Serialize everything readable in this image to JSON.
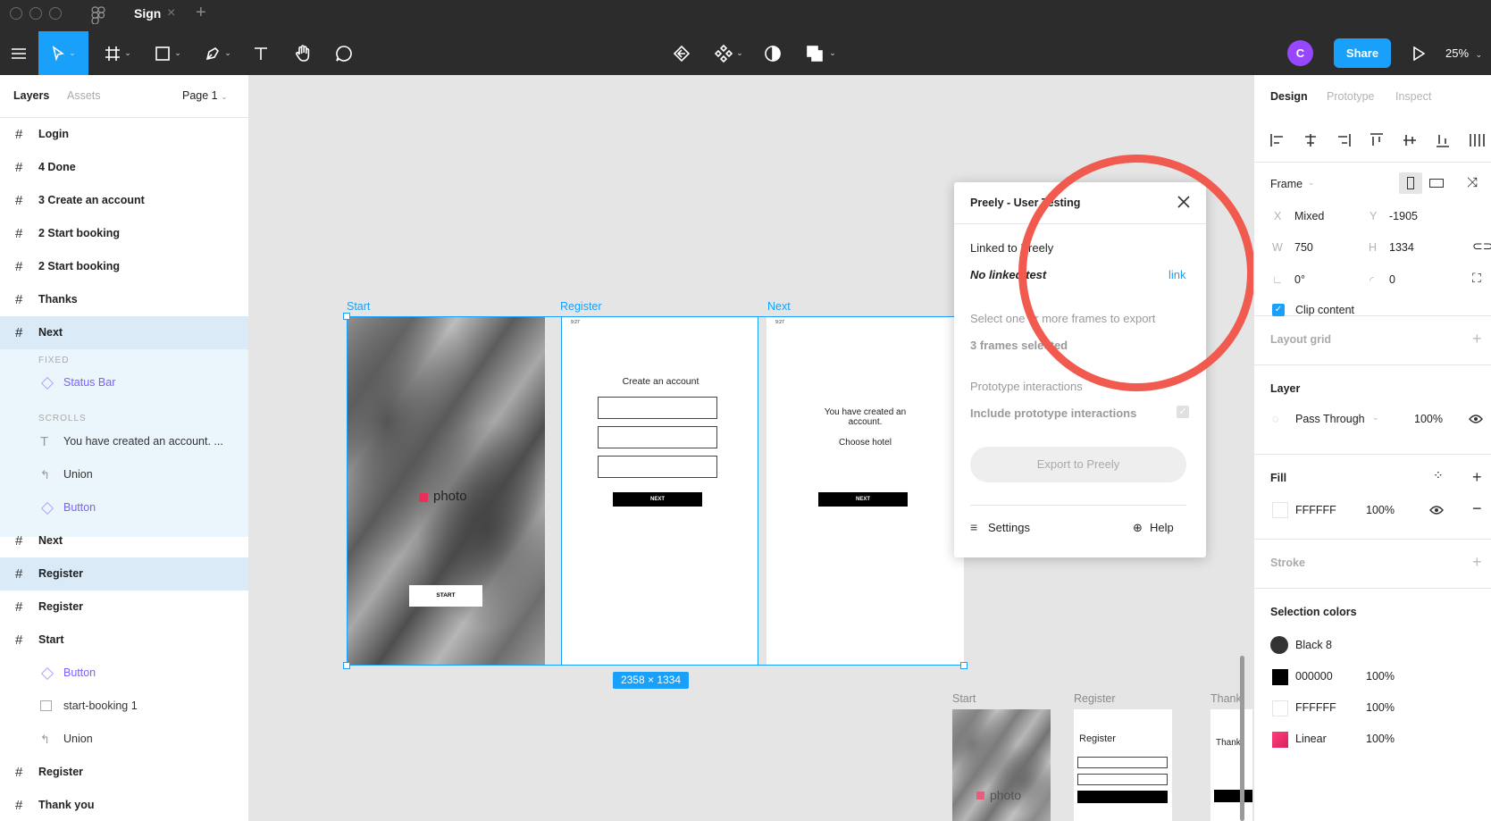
{
  "titlebar": {
    "tab_title": "Sign",
    "tab_close": "×",
    "tab_add": "+"
  },
  "toolbar": {
    "share_label": "Share",
    "avatar_initial": "C",
    "zoom": "25%",
    "accent_color": "#18a0fb"
  },
  "left_panel": {
    "tabs": [
      "Layers",
      "Assets"
    ],
    "page": "Page 1",
    "layers": [
      {
        "label": "Login"
      },
      {
        "label": "4 Done"
      },
      {
        "label": "3 Create an account"
      },
      {
        "label": "2 Start booking"
      },
      {
        "label": "2 Start booking"
      },
      {
        "label": "Thanks"
      },
      {
        "label": "Next"
      },
      {
        "label": "FIXED"
      },
      {
        "label": "Status Bar"
      },
      {
        "label": "SCROLLS"
      },
      {
        "label": "You have created an account. ..."
      },
      {
        "label": "Union"
      },
      {
        "label": "Button"
      },
      {
        "label": "Next"
      },
      {
        "label": "Register"
      },
      {
        "label": "Register"
      },
      {
        "label": "Start"
      },
      {
        "label": "Button"
      },
      {
        "label": "start-booking 1"
      },
      {
        "label": "Union"
      },
      {
        "label": "Register"
      },
      {
        "label": "Thank you"
      }
    ]
  },
  "canvas": {
    "frames": [
      {
        "label": "Start"
      },
      {
        "label": "Register"
      },
      {
        "label": "Next"
      }
    ],
    "start_logo": "photo",
    "start_button": "START",
    "register_heading": "Create an account",
    "register_button": "NEXT",
    "next_text": "You have created an account.",
    "next_subtext": "Choose hotel",
    "next_button": "NEXT",
    "selection_size": "2358 × 1334",
    "thumbs": [
      {
        "label": "Start"
      },
      {
        "label": "Register"
      },
      {
        "label": "Thank"
      }
    ],
    "thumb_logo": "photo",
    "thumb_register_heading": "Register",
    "thumb_thanks_text": "Thank"
  },
  "plugin": {
    "title": "Preely - User Testing",
    "linked_label": "Linked to Preely",
    "linked_value": "No linked test",
    "link_action": "link",
    "select_hint": "Select one or more frames to export",
    "frames_selected": "3 frames selected",
    "prototype_label": "Prototype interactions",
    "include_label": "Include prototype interactions",
    "export_button": "Export to Preely",
    "settings_label": "Settings",
    "help_label": "Help"
  },
  "right_panel": {
    "tabs": [
      "Design",
      "Prototype",
      "Inspect"
    ],
    "frame_label": "Frame",
    "x_label": "X",
    "x_value": "Mixed",
    "y_label": "Y",
    "y_value": "-1905",
    "w_label": "W",
    "w_value": "750",
    "h_label": "H",
    "h_value": "1334",
    "rotation": "0°",
    "radius": "0",
    "clip_content": "Clip content",
    "layout_grid": "Layout grid",
    "layer_title": "Layer",
    "blend_mode": "Pass Through",
    "layer_opacity": "100%",
    "fill_title": "Fill",
    "fill_hex": "FFFFFF",
    "fill_opacity": "100%",
    "stroke_title": "Stroke",
    "selection_colors_title": "Selection colors",
    "selection_colors": [
      {
        "name": "Black 8",
        "opacity": "",
        "color": "#333333"
      },
      {
        "name": "000000",
        "opacity": "100%",
        "color": "#000000"
      },
      {
        "name": "FFFFFF",
        "opacity": "100%",
        "color": "#ffffff"
      },
      {
        "name": "Linear",
        "opacity": "100%",
        "color": "#e8305a"
      }
    ]
  }
}
